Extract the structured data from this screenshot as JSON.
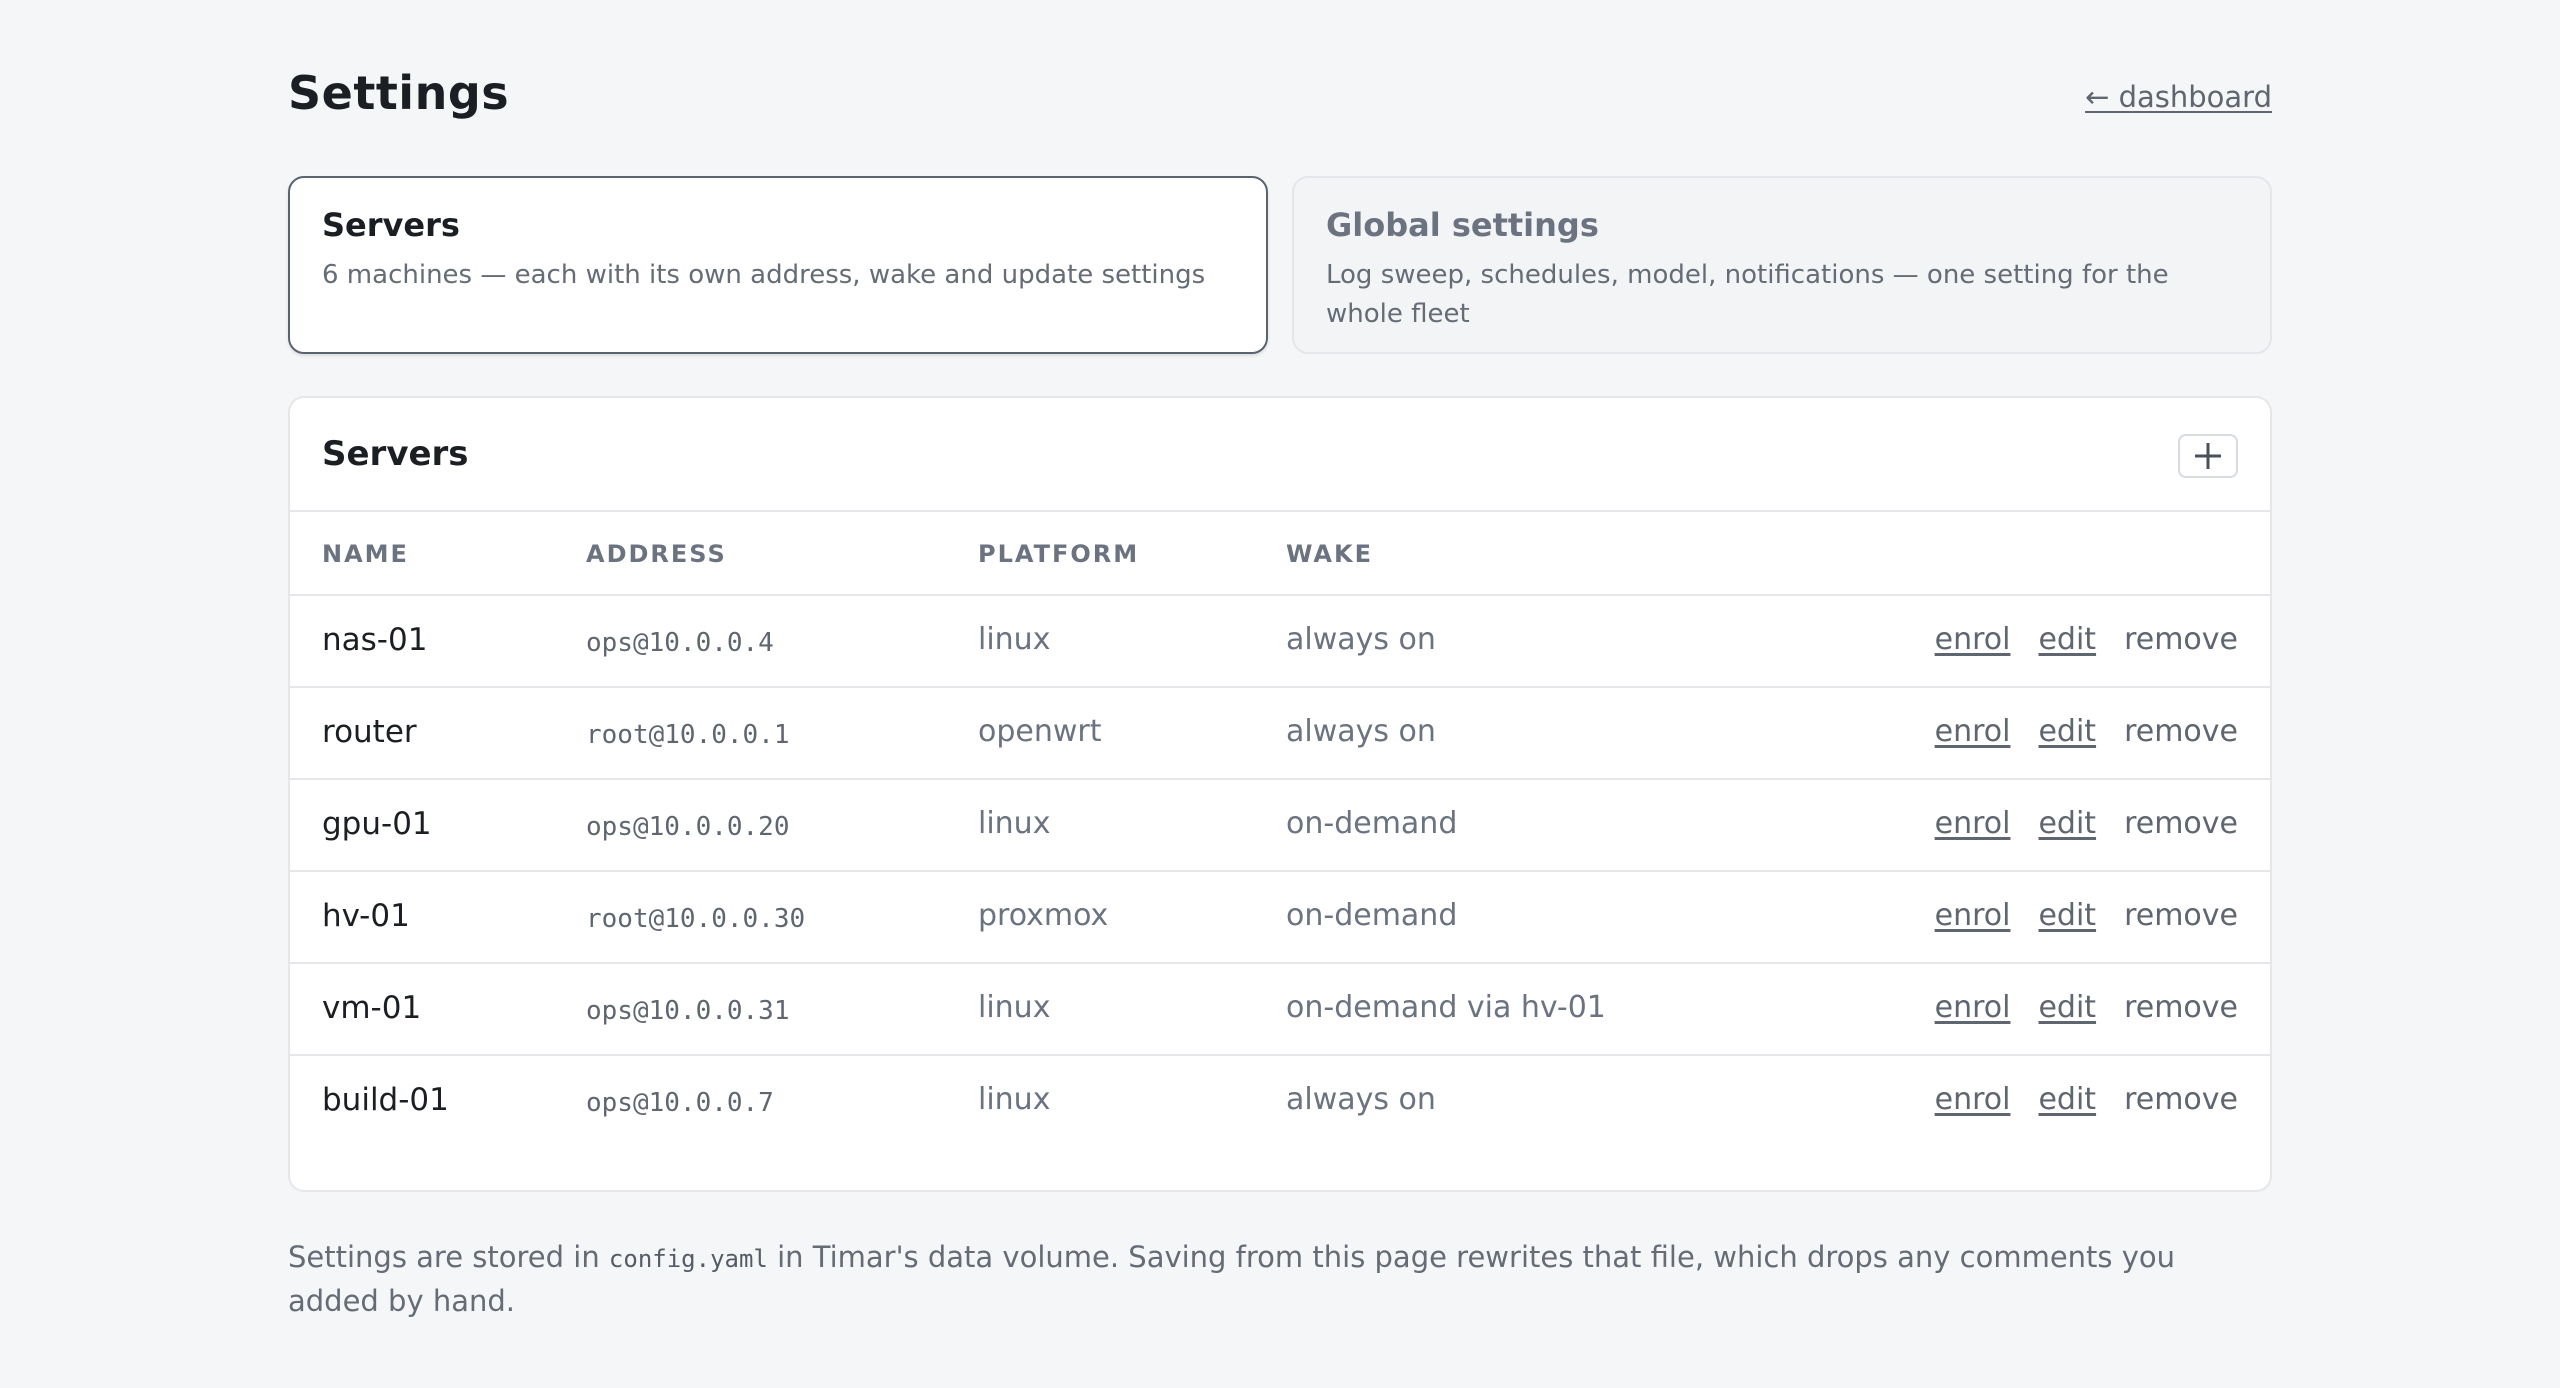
{
  "header": {
    "title": "Settings",
    "back_link": "← dashboard"
  },
  "cards": [
    {
      "title": "Servers",
      "description": "6 machines — each with its own address, wake and update settings"
    },
    {
      "title": "Global settings",
      "description": "Log sweep, schedules, model, notifications — one setting for the whole fleet"
    }
  ],
  "servers": {
    "title": "Servers",
    "add_icon": "plus-icon",
    "columns": [
      "NAME",
      "ADDRESS",
      "PLATFORM",
      "WAKE"
    ],
    "actions": {
      "enrol": "enrol",
      "edit": "edit",
      "remove": "remove"
    },
    "rows": [
      {
        "name": "nas-01",
        "address": "ops@10.0.0.4",
        "platform": "linux",
        "wake": "always on"
      },
      {
        "name": "router",
        "address": "root@10.0.0.1",
        "platform": "openwrt",
        "wake": "always on"
      },
      {
        "name": "gpu-01",
        "address": "ops@10.0.0.20",
        "platform": "linux",
        "wake": "on-demand"
      },
      {
        "name": "hv-01",
        "address": "root@10.0.0.30",
        "platform": "proxmox",
        "wake": "on-demand"
      },
      {
        "name": "vm-01",
        "address": "ops@10.0.0.31",
        "platform": "linux",
        "wake": "on-demand via hv-01"
      },
      {
        "name": "build-01",
        "address": "ops@10.0.0.7",
        "platform": "linux",
        "wake": "always on"
      }
    ]
  },
  "footnote": {
    "before": "Settings are stored in ",
    "file": "config.yaml",
    "after": " in Timar's data volume. Saving from this page rewrites that file, which drops any comments you added by hand."
  }
}
